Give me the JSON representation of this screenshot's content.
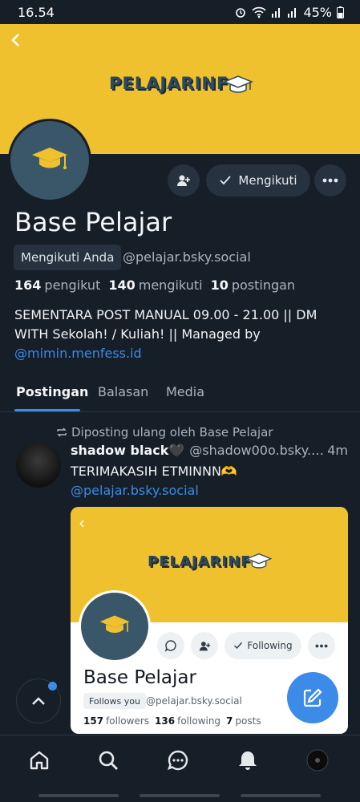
{
  "status_bar": {
    "time": "16.54",
    "battery": "45%"
  },
  "colors": {
    "background": "#161e27",
    "banner": "#efc12e",
    "accent": "#3c8be8",
    "button_bg": "#263240"
  },
  "banner": {
    "logo_text": "PELAJARINF"
  },
  "profile": {
    "display_name": "Base Pelajar",
    "follows_you_badge": "Mengikuti Anda",
    "handle": "@pelajar.bsky.social",
    "follow_button_label": "Mengikuti",
    "followers_count": "164",
    "followers_label": "pengikut",
    "following_count": "140",
    "following_label": "mengikuti",
    "posts_count": "10",
    "posts_label": "postingan",
    "bio_text": "SEMENTARA POST MANUAL 09.00 - 21.00 || DM WITH Sekolah! / Kuliah! || Managed by ",
    "bio_link": "@mimin.menfess.id"
  },
  "tabs": [
    {
      "label": "Postingan",
      "active": true
    },
    {
      "label": "Balasan",
      "active": false
    },
    {
      "label": "Media",
      "active": false
    }
  ],
  "post": {
    "repost_text": "Diposting ulang oleh Base Pelajar",
    "author": "shadow black🖤",
    "handle": "@shadow00o.bsky.soc...",
    "time": "4m",
    "text": "TERIMAKASIH ETMINNN🫶 ",
    "link": "@pelajar.bsky.social",
    "embed": {
      "logo_text": "PELAJARINF",
      "display_name": "Base Pelajar",
      "follows_you_badge": "Follows you",
      "handle": "@pelajar.bsky.social",
      "follow_button_label": "Following",
      "followers_count": "157",
      "followers_label": "followers",
      "following_count": "136",
      "following_label": "following",
      "posts_count": "7",
      "posts_label": "posts"
    }
  },
  "bottom_nav": [
    {
      "icon": "home-icon"
    },
    {
      "icon": "search-icon"
    },
    {
      "icon": "chat-icon"
    },
    {
      "icon": "bell-icon"
    },
    {
      "icon": "profile-avatar"
    }
  ]
}
